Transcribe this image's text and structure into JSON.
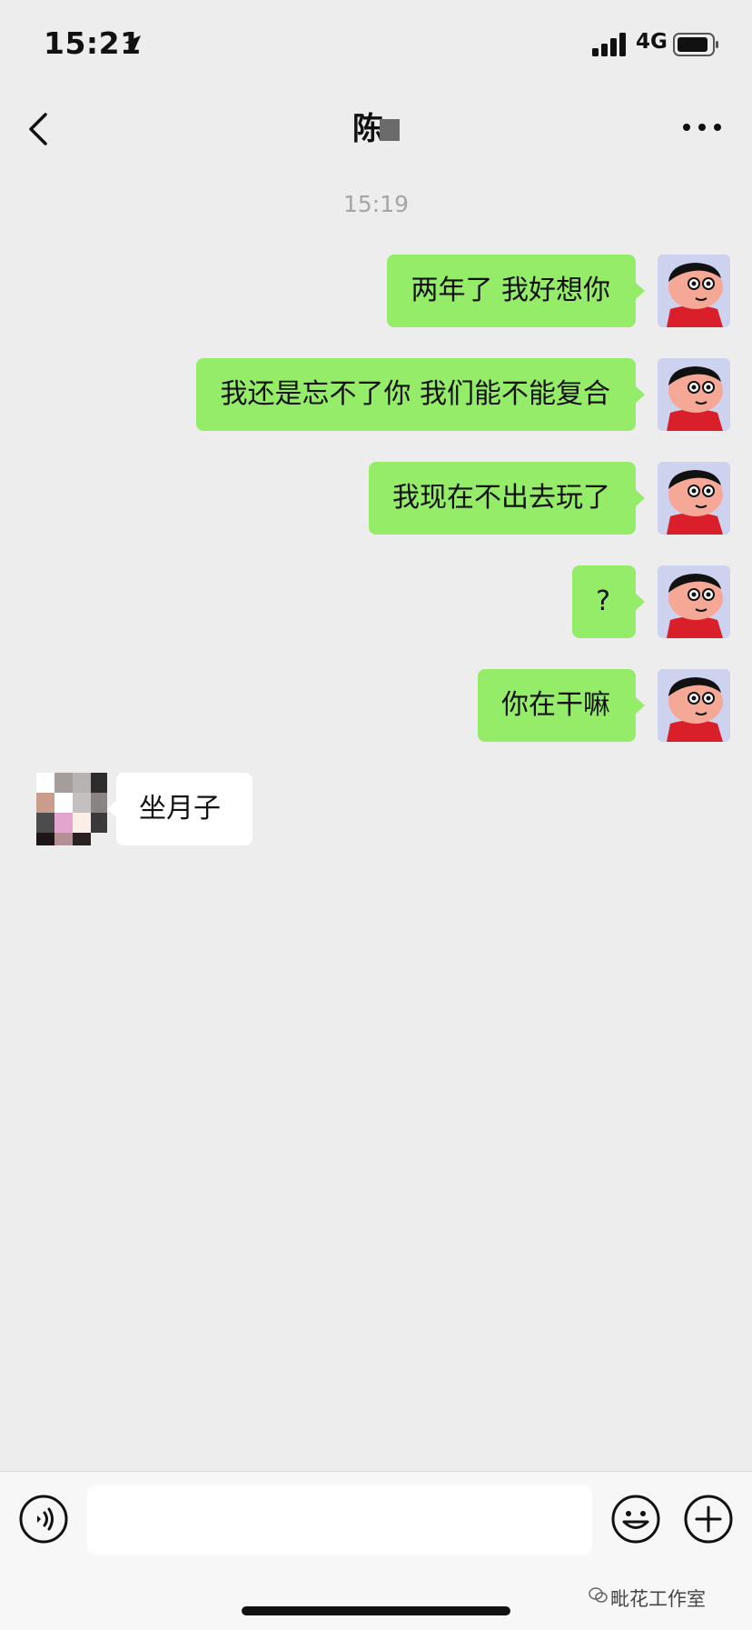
{
  "status_bar": {
    "time": "15:21",
    "network": "4G"
  },
  "header": {
    "title": "陈"
  },
  "timestamp": "15:19",
  "messages": [
    {
      "text": "两年了 我好想你",
      "sender": "self"
    },
    {
      "text": "我还是忘不了你 我们能不能复合",
      "sender": "self"
    },
    {
      "text": "我现在不出去玩了",
      "sender": "self"
    },
    {
      "text": "?",
      "sender": "self"
    },
    {
      "text": "你在干嘛",
      "sender": "self"
    },
    {
      "text": "坐月子",
      "sender": "other"
    }
  ],
  "input": {
    "value": ""
  },
  "watermark": "毗花工作室",
  "colors": {
    "background": "#ededed",
    "bubble_self": "#95ec69",
    "bubble_other": "#ffffff"
  },
  "icons": [
    "location-arrow-icon",
    "signal-icon",
    "battery-icon",
    "back-chevron-icon",
    "more-dots-icon",
    "voice-icon",
    "emoji-icon",
    "plus-icon"
  ]
}
